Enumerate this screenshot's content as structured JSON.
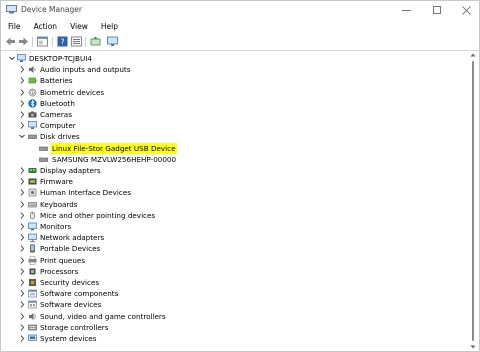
{
  "window": {
    "title": "Device Manager",
    "minimize_icon": "minimize-icon",
    "maximize_icon": "maximize-icon",
    "close_icon": "close-icon"
  },
  "menu": [
    "File",
    "Action",
    "View",
    "Help"
  ],
  "toolbar": [
    "back-icon",
    "forward-icon",
    "properties-icon",
    "help-icon",
    "details-icon",
    "update-driver-icon",
    "monitor-icon"
  ],
  "tree": {
    "root": "DESKTOP-TCJBUI4",
    "categories": [
      {
        "label": "Audio inputs and outputs",
        "icon": "speaker-icon"
      },
      {
        "label": "Batteries",
        "icon": "battery-icon"
      },
      {
        "label": "Biometric devices",
        "icon": "fingerprint-icon"
      },
      {
        "label": "Bluetooth",
        "icon": "bluetooth-icon"
      },
      {
        "label": "Cameras",
        "icon": "camera-icon"
      },
      {
        "label": "Computer",
        "icon": "computer-icon"
      },
      {
        "label": "Disk drives",
        "icon": "disk-drive-icon",
        "expanded": true,
        "children": [
          {
            "label": "Linux File-Stor Gadget USB Device",
            "selected": true
          },
          {
            "label": "SAMSUNG MZVLW256HEHP-00000"
          }
        ]
      },
      {
        "label": "Display adapters",
        "icon": "display-adapter-icon"
      },
      {
        "label": "Firmware",
        "icon": "firmware-icon"
      },
      {
        "label": "Human Interface Devices",
        "icon": "hid-icon"
      },
      {
        "label": "Keyboards",
        "icon": "keyboard-icon"
      },
      {
        "label": "Mice and other pointing devices",
        "icon": "mouse-icon"
      },
      {
        "label": "Monitors",
        "icon": "monitor-icon"
      },
      {
        "label": "Network adapters",
        "icon": "network-adapter-icon"
      },
      {
        "label": "Portable Devices",
        "icon": "portable-device-icon"
      },
      {
        "label": "Print queues",
        "icon": "printer-icon"
      },
      {
        "label": "Processors",
        "icon": "processor-icon"
      },
      {
        "label": "Security devices",
        "icon": "security-icon"
      },
      {
        "label": "Software components",
        "icon": "software-component-icon"
      },
      {
        "label": "Software devices",
        "icon": "software-device-icon"
      },
      {
        "label": "Sound, video and game controllers",
        "icon": "sound-icon"
      },
      {
        "label": "Storage controllers",
        "icon": "storage-controller-icon"
      },
      {
        "label": "System devices",
        "icon": "system-device-icon"
      }
    ]
  },
  "colors": {
    "selection": "#ffff1a",
    "accent": "#1e73be"
  }
}
